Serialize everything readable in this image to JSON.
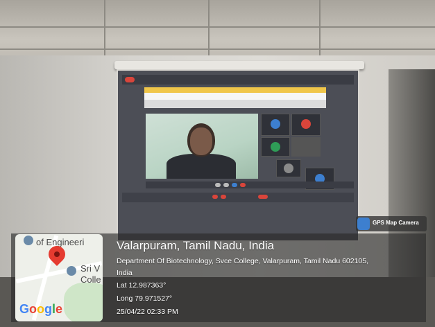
{
  "badge": {
    "label": "GPS Map Camera",
    "icon": "map-camera-icon"
  },
  "map": {
    "label_top": "of Engineeri",
    "label_mid1": "Sri V",
    "label_mid2": "Colle",
    "logo": "Google",
    "pin_color": "#e53b30"
  },
  "location": {
    "title": "Valarpuram, Tamil Nadu, India",
    "address_line1": "Department Of Biotechnology, Svce College, Valarpuram, Tamil Nadu 602105,",
    "address_line2": "India",
    "lat": "Lat 12.987363°",
    "long": "Long 79.971527°",
    "datetime": "25/04/22 02:33 PM"
  }
}
